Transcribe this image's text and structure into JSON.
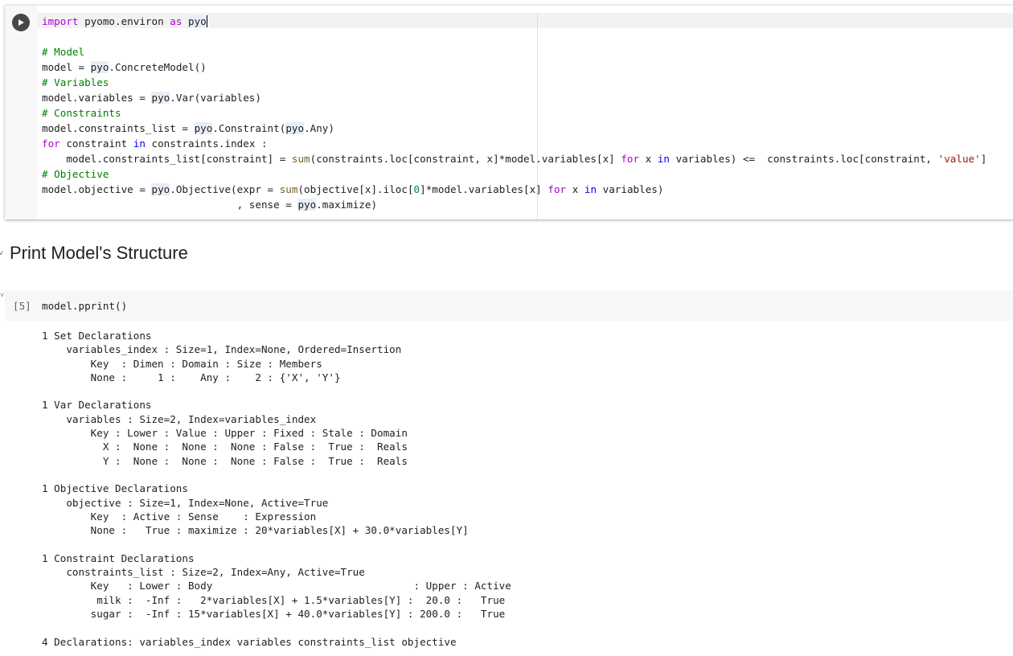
{
  "code_cell": {
    "run_icon": "play-icon",
    "lines": [
      "import pyomo.environ as pyo",
      "",
      "# Model",
      "model = pyo.ConcreteModel()",
      "# Variables",
      "model.variables = pyo.Var(variables)",
      "# Constraints",
      "model.constraints_list = pyo.Constraint(pyo.Any)",
      "for constraint in constraints.index :",
      "    model.constraints_list[constraint] = sum(constraints.loc[constraint, x]*model.variables[x] for x in variables) <=  constraints.loc[constraint, 'value']",
      "# Objective",
      "model.objective = pyo.Objective(expr = sum(objective[x].iloc[0]*model.variables[x] for x in variables)",
      "                                , sense = pyo.maximize)"
    ]
  },
  "section": {
    "title": "Print Model's Structure",
    "collapse_icon": "chevron-down-icon"
  },
  "pprint_cell": {
    "execution_count": "[5]",
    "code": "model.pprint()"
  },
  "output": {
    "lines": [
      "1 Set Declarations",
      "    variables_index : Size=1, Index=None, Ordered=Insertion",
      "        Key  : Dimen : Domain : Size : Members",
      "        None :     1 :    Any :    2 : {'X', 'Y'}",
      "",
      "1 Var Declarations",
      "    variables : Size=2, Index=variables_index",
      "        Key : Lower : Value : Upper : Fixed : Stale : Domain",
      "          X :  None :  None :  None : False :  True :  Reals",
      "          Y :  None :  None :  None : False :  True :  Reals",
      "",
      "1 Objective Declarations",
      "    objective : Size=1, Index=None, Active=True",
      "        Key  : Active : Sense    : Expression",
      "        None :   True : maximize : 20*variables[X] + 30.0*variables[Y]",
      "",
      "1 Constraint Declarations",
      "    constraints_list : Size=2, Index=Any, Active=True",
      "        Key   : Lower : Body                                 : Upper : Active",
      "         milk :  -Inf :   2*variables[X] + 1.5*variables[Y] :  20.0 :   True",
      "        sugar :  -Inf : 15*variables[X] + 40.0*variables[Y] : 200.0 :   True",
      "",
      "4 Declarations: variables_index variables constraints_list objective"
    ]
  }
}
